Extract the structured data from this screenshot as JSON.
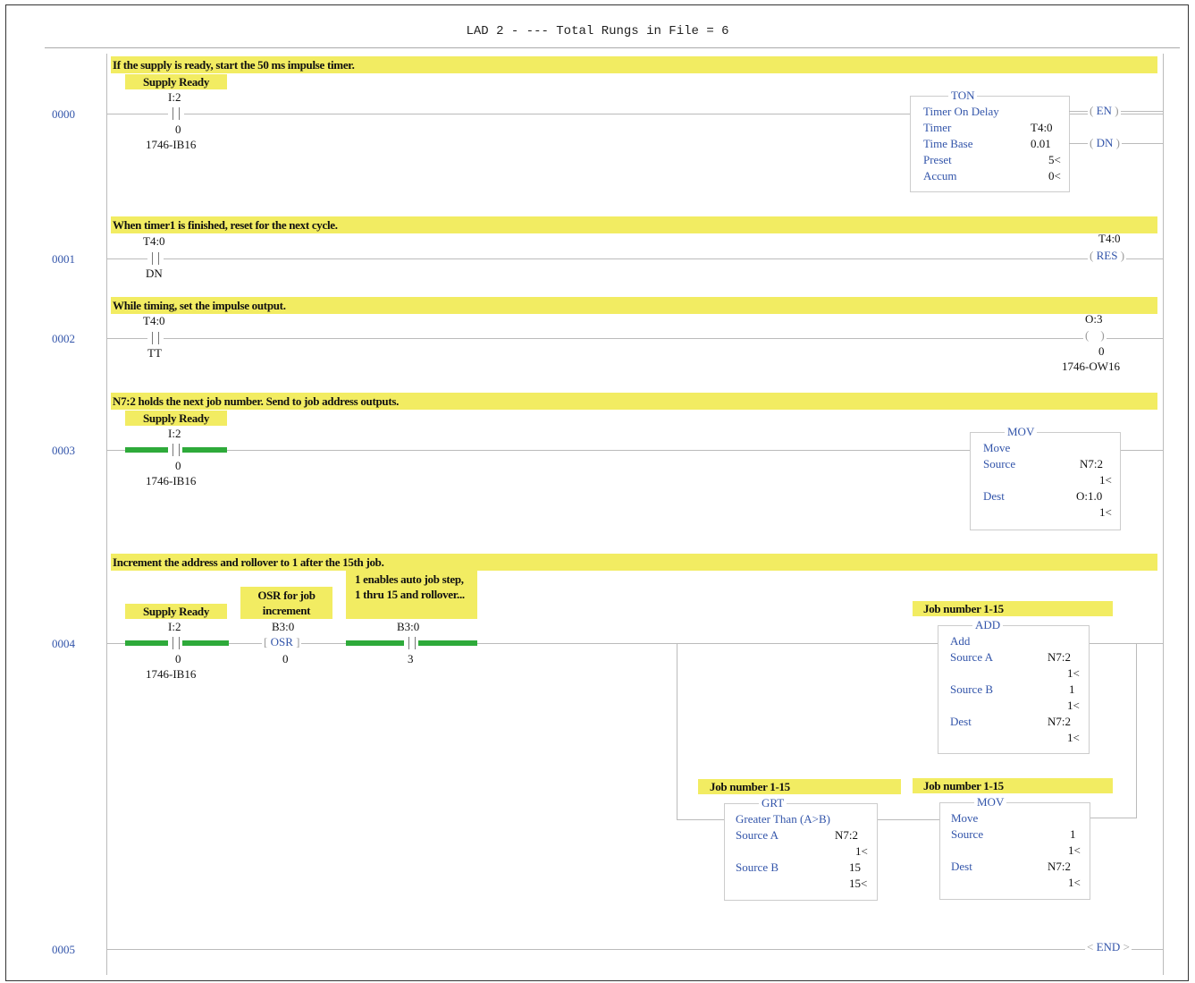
{
  "header": {
    "title": "LAD 2 -  --- Total Rungs in File = 6"
  },
  "rungs": [
    {
      "number": "0000",
      "comment": "If the supply is ready, start the 50 ms impulse timer.",
      "contact": {
        "label": "Supply Ready",
        "address": "I:2",
        "bit": "0",
        "module": "1746-IB16"
      },
      "ton": {
        "mnemonic": "TON",
        "name": "Timer On Delay",
        "timer_label": "Timer",
        "timer_value": "T4:0",
        "timebase_label": "Time Base",
        "timebase_value": "0.01",
        "preset_label": "Preset",
        "preset_value": "5<",
        "accum_label": "Accum",
        "accum_value": "0<",
        "en": "EN",
        "dn": "DN"
      }
    },
    {
      "number": "0001",
      "comment": "When timer1 is finished, reset for the next cycle.",
      "contact": {
        "address": "T4:0",
        "bit": "DN"
      },
      "coil": {
        "address": "T4:0",
        "type": "RES"
      }
    },
    {
      "number": "0002",
      "comment": "While timing, set the impulse output.",
      "contact": {
        "address": "T4:0",
        "bit": "TT"
      },
      "coil": {
        "address": "O:3",
        "bit": "0",
        "module": "1746-OW16"
      }
    },
    {
      "number": "0003",
      "comment": "N7:2 holds the next job number.  Send to job address outputs.",
      "contact": {
        "label": "Supply Ready",
        "address": "I:2",
        "bit": "0",
        "module": "1746-IB16"
      },
      "mov": {
        "mnemonic": "MOV",
        "name": "Move",
        "source_label": "Source",
        "source_value": "N7:2",
        "source_sub": "1<",
        "dest_label": "Dest",
        "dest_value": "O:1.0",
        "dest_sub": "1<"
      }
    },
    {
      "number": "0004",
      "comment": "Increment the address and rollover to 1 after the 15th job.",
      "contact1": {
        "label": "Supply Ready",
        "address": "I:2",
        "bit": "0",
        "module": "1746-IB16"
      },
      "osr": {
        "label": "OSR for job increment",
        "address": "B3:0",
        "type": "OSR",
        "bit": "0"
      },
      "contact3": {
        "label": "1 enables auto job step, 1 thru 15 and rollover...",
        "address": "B3:0",
        "bit": "3"
      },
      "add": {
        "label": "Job number 1-15",
        "mnemonic": "ADD",
        "name": "Add",
        "a_label": "Source A",
        "a_value": "N7:2",
        "a_sub": "1<",
        "b_label": "Source B",
        "b_value": "1",
        "b_sub": "1<",
        "dest_label": "Dest",
        "dest_value": "N7:2",
        "dest_sub": "1<"
      },
      "grt": {
        "label": "Job number 1-15",
        "mnemonic": "GRT",
        "name": "Greater Than (A>B)",
        "a_label": "Source A",
        "a_value": "N7:2",
        "a_sub": "1<",
        "b_label": "Source B",
        "b_value": "15",
        "b_sub": "15<"
      },
      "mov": {
        "label": "Job number 1-15",
        "mnemonic": "MOV",
        "name": "Move",
        "source_label": "Source",
        "source_value": "1",
        "source_sub": "1<",
        "dest_label": "Dest",
        "dest_value": "N7:2",
        "dest_sub": "1<"
      }
    },
    {
      "number": "0005",
      "end": "END"
    }
  ],
  "colors": {
    "comment_bg": "#f2ec62",
    "energized": "#2eaa3a",
    "instruction_text": "#3355aa"
  }
}
